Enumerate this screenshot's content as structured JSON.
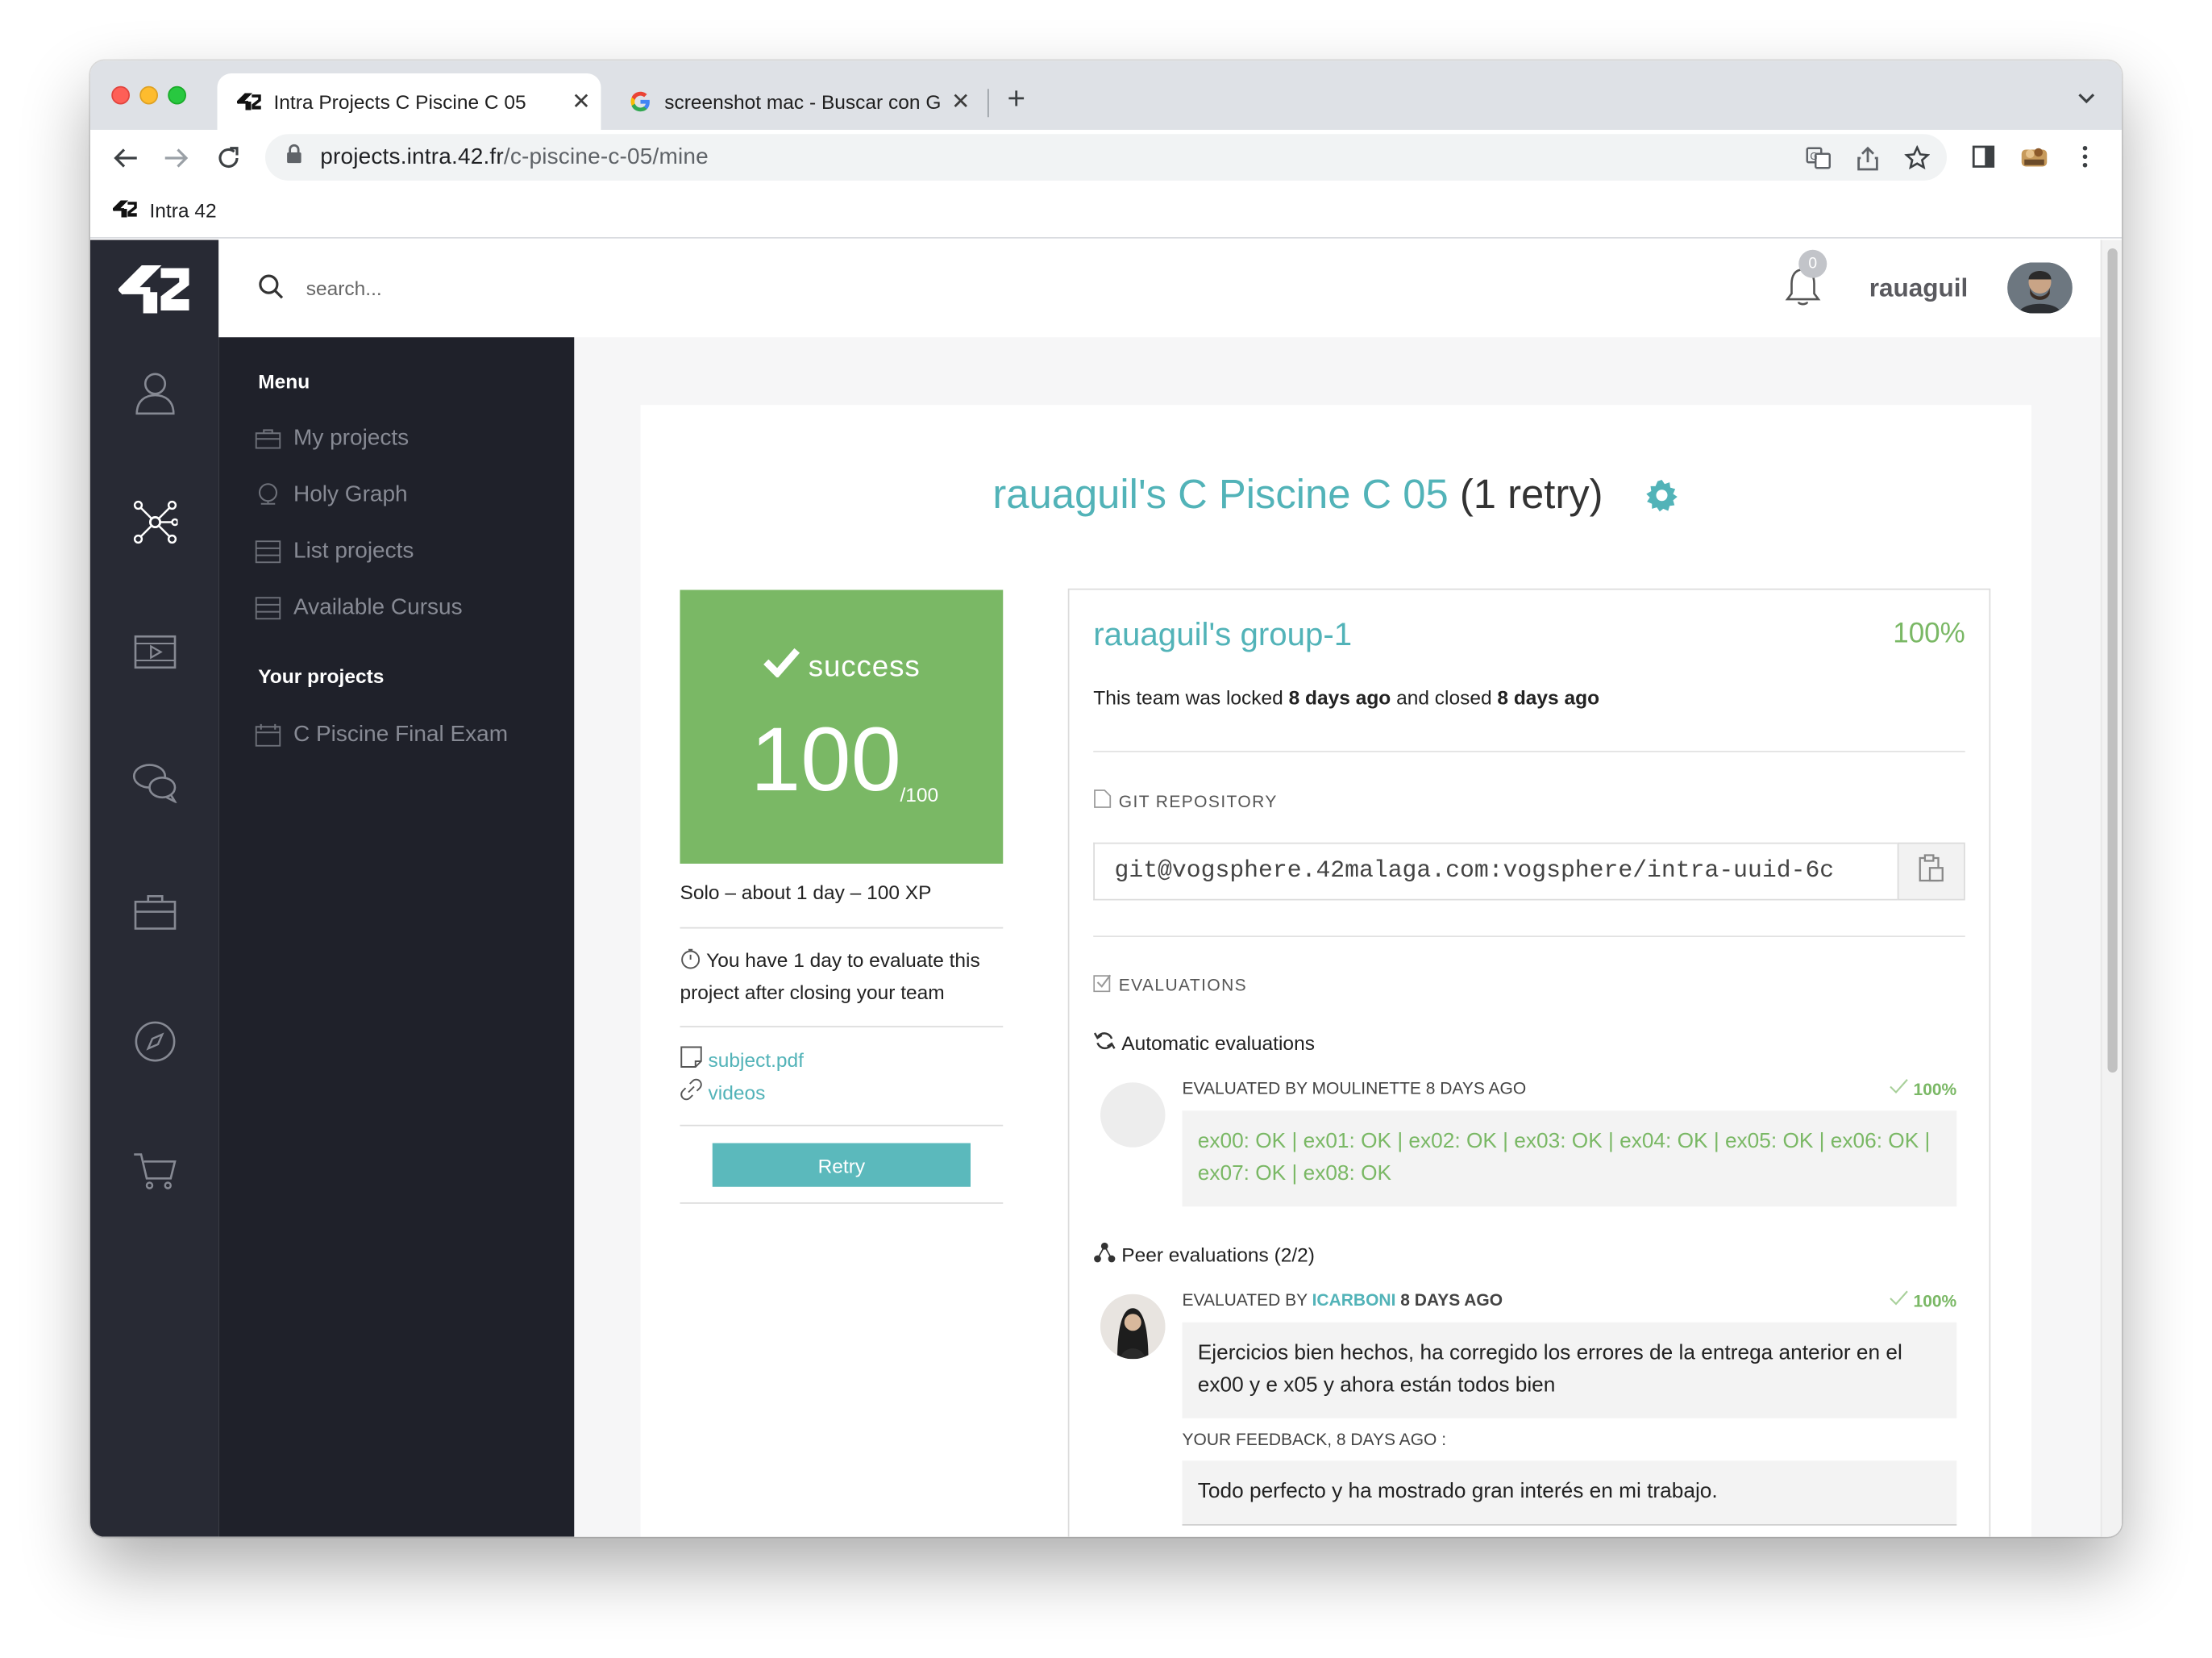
{
  "browser": {
    "tabs": [
      {
        "title": "Intra Projects C Piscine C 05",
        "favicon": "42-logo-icon",
        "active": true
      },
      {
        "title": "screenshot mac - Buscar con G",
        "favicon": "google-icon",
        "active": false
      }
    ],
    "url_host": "projects.intra.42.fr",
    "url_path": "/c-piscine-c-05/mine",
    "bookmark": "Intra 42"
  },
  "header": {
    "search_placeholder": "search...",
    "notifications_count": "0",
    "username": "rauaguil"
  },
  "menu": {
    "title": "Menu",
    "items": [
      {
        "label": "My projects",
        "icon": "briefcase-icon"
      },
      {
        "label": "Holy Graph",
        "icon": "globe-icon"
      },
      {
        "label": "List projects",
        "icon": "list-icon"
      },
      {
        "label": "Available Cursus",
        "icon": "list-icon"
      }
    ],
    "your_projects_title": "Your projects",
    "your_projects": [
      {
        "label": "C Piscine Final Exam",
        "icon": "calendar-icon"
      }
    ]
  },
  "project": {
    "title_owner": "rauaguil's C Piscine C 05",
    "title_suffix": "(1 retry)",
    "status": "success",
    "score": "100",
    "max": "/100",
    "meta": "Solo – about 1 day – 100 XP",
    "evaluate_note": "You have 1 day to evaluate this project after closing your team",
    "links": [
      "subject.pdf",
      "videos"
    ],
    "retry_label": "Retry"
  },
  "team": {
    "name": "rauaguil's group-1",
    "percent": "100%",
    "locked_prefix": "This team was locked",
    "locked_when": "8 days ago",
    "closed_prefix": "and closed",
    "closed_when": "8 days ago",
    "git_heading": "GIT REPOSITORY",
    "git_url": "git@vogsphere.42malaga.com:vogsphere/intra-uuid-6c",
    "evaluations_heading": "EVALUATIONS",
    "auto_heading": "Automatic evaluations",
    "auto_eval": {
      "by": "EVALUATED BY MOULINETTE 8 DAYS AGO",
      "percent": "100%",
      "result": "ex00: OK | ex01: OK | ex02: OK | ex03: OK | ex04: OK | ex05: OK | ex06: OK | ex07: OK | ex08: OK"
    },
    "peer_heading": "Peer evaluations (2/2)",
    "peer_eval": {
      "by_prefix": "EVALUATED BY",
      "login": "ICARBONI",
      "ago": "8 DAYS AGO",
      "percent": "100%",
      "comment": "Ejercicios bien hechos, ha corregido los errores de la entrega anterior en el ex00 y e x05 y ahora están todos bien",
      "feedback_label": "YOUR FEEDBACK, 8 DAYS AGO :",
      "feedback": "Todo perfecto y ha mostrado gran interés en mi trabajo."
    }
  }
}
